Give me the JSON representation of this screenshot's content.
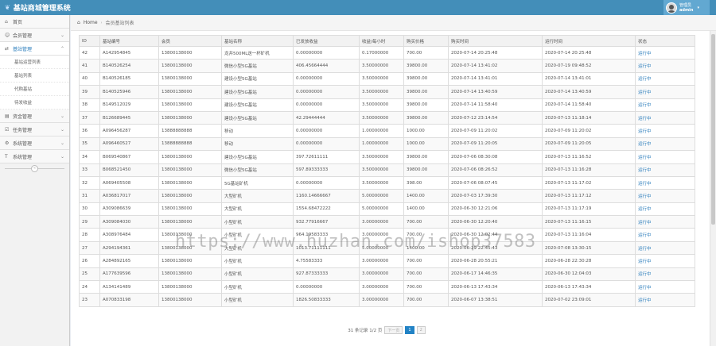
{
  "app": {
    "title": "基站商城管理系统"
  },
  "user": {
    "role": "管理员",
    "name": "admin"
  },
  "sidebar": {
    "items": [
      {
        "label": "首页",
        "icon": "home-icon",
        "has_arrow": false
      },
      {
        "label": "会员管理",
        "icon": "user-icon",
        "has_arrow": true
      },
      {
        "label": "基站管理",
        "icon": "shuffle-icon",
        "has_arrow": true,
        "open": true
      }
    ],
    "subitems": [
      {
        "label": "基站运营列表"
      },
      {
        "label": "基站列表"
      },
      {
        "label": "代购基站"
      },
      {
        "label": "待发收益"
      }
    ],
    "more_items": [
      {
        "label": "资金管理",
        "icon": "wallet-icon"
      },
      {
        "label": "任务管理",
        "icon": "task-icon"
      },
      {
        "label": "系统管理",
        "icon": "gear-icon"
      },
      {
        "label": "系统管理",
        "icon": "text-icon"
      }
    ]
  },
  "breadcrumb": {
    "home": "Home",
    "current": "会员基站列表"
  },
  "table": {
    "columns": [
      "ID",
      "基站编号",
      "会员",
      "基站名称",
      "已发放收益",
      "收益/每小时",
      "购买价格",
      "购买时间",
      "运行时间",
      "状态"
    ],
    "rows": [
      [
        "42",
        "A142954845",
        "13800138000",
        "龙井500ML送一杯矿机",
        "0.00000000",
        "0.17000000",
        "700.00",
        "2020-07-14 20:25:48",
        "2020-07-14 20:25:48",
        "运行中"
      ],
      [
        "41",
        "B140526254",
        "13800138000",
        "微信小型5G基站",
        "406.45664444",
        "3.50000000",
        "39800.00",
        "2020-07-14 13:41:02",
        "2020-07-19 09:48:52",
        "运行中"
      ],
      [
        "40",
        "B140526185",
        "13800138000",
        "建设小型5G基站",
        "0.00000000",
        "3.50000000",
        "39800.00",
        "2020-07-14 13:41:01",
        "2020-07-14 13:41:01",
        "运行中"
      ],
      [
        "39",
        "B140525946",
        "13800138000",
        "建设小型5G基站",
        "0.00000000",
        "3.50000000",
        "39800.00",
        "2020-07-14 13:40:59",
        "2020-07-14 13:40:59",
        "运行中"
      ],
      [
        "38",
        "B149512029",
        "13800138000",
        "建设小型5G基站",
        "0.00000000",
        "3.50000000",
        "39800.00",
        "2020-07-14 11:58:40",
        "2020-07-14 11:58:40",
        "运行中"
      ],
      [
        "37",
        "B126689445",
        "13800138000",
        "建设小型5G基站",
        "42.29444444",
        "3.50000000",
        "39800.00",
        "2020-07-12 23:14:54",
        "2020-07-13 11:18:14",
        "运行中"
      ],
      [
        "36",
        "A096456287",
        "13888888888",
        "移动",
        "0.00000000",
        "1.00000000",
        "1000.00",
        "2020-07-09 11:20:02",
        "2020-07-09 11:20:02",
        "运行中"
      ],
      [
        "35",
        "A096460527",
        "13888888888",
        "移动",
        "0.00000000",
        "1.00000000",
        "1000.00",
        "2020-07-09 11:20:05",
        "2020-07-09 11:20:05",
        "运行中"
      ],
      [
        "34",
        "B069540867",
        "13800138000",
        "建设小型5G基站",
        "397.72611111",
        "3.50000000",
        "39800.00",
        "2020-07-06 08:30:08",
        "2020-07-13 11:16:52",
        "运行中"
      ],
      [
        "33",
        "B068521450",
        "13800138000",
        "微信小型5G基站",
        "597.89333333",
        "3.50000000",
        "39800.00",
        "2020-07-06 08:26:52",
        "2020-07-13 11:16:28",
        "运行中"
      ],
      [
        "32",
        "A069405508",
        "13800138000",
        "5G基站矿机",
        "0.00000000",
        "3.50000000",
        "398.00",
        "2020-07-06 08:07:45",
        "2020-07-13 11:17:02",
        "运行中"
      ],
      [
        "31",
        "A036817017",
        "13800138000",
        "大型矿机",
        "1160.14666667",
        "5.00000000",
        "1400.00",
        "2020-07-03 17:39:30",
        "2020-07-13 11:17:12",
        "运行中"
      ],
      [
        "30",
        "A309086639",
        "13800138000",
        "大型矿机",
        "1554.68472222",
        "5.00000000",
        "1400.00",
        "2020-06-30 12:21:06",
        "2020-07-13 11:17:19",
        "运行中"
      ],
      [
        "29",
        "A309084030",
        "13800138000",
        "小型矿机",
        "932.77916667",
        "3.00000000",
        "700.00",
        "2020-06-30 12:20:40",
        "2020-07-13 11:16:15",
        "运行中"
      ],
      [
        "28",
        "A308976484",
        "13800138000",
        "小型矿机",
        "964.19583333",
        "3.00000000",
        "700.00",
        "2020-06-30 12:02:44",
        "2020-07-13 11:16:04",
        "运行中"
      ],
      [
        "27",
        "A294194361",
        "13800138000",
        "大型矿机",
        "1013.71111111",
        "5.00000000",
        "1400.00",
        "2020-06-29 22:45:43",
        "2020-07-08 13:30:15",
        "运行中"
      ],
      [
        "26",
        "A284892165",
        "13800138000",
        "小型矿机",
        "4.75583333",
        "3.00000000",
        "700.00",
        "2020-06-28 20:55:21",
        "2020-06-28 22:30:28",
        "运行中"
      ],
      [
        "25",
        "A177639596",
        "13800138000",
        "小型矿机",
        "927.87333333",
        "3.00000000",
        "700.00",
        "2020-06-17 14:46:35",
        "2020-06-30 12:04:03",
        "运行中"
      ],
      [
        "24",
        "A134141489",
        "13800138000",
        "小型矿机",
        "0.00000000",
        "3.00000000",
        "700.00",
        "2020-06-13 17:43:34",
        "2020-06-13 17:43:34",
        "运行中"
      ],
      [
        "23",
        "A070833198",
        "13800138000",
        "小型矿机",
        "1826.50833333",
        "3.00000000",
        "700.00",
        "2020-06-07 13:38:51",
        "2020-07-02 23:09:01",
        "运行中"
      ]
    ]
  },
  "pager": {
    "summary": "31 条记录 1/2 页",
    "prev": "下一页",
    "pages": [
      "1",
      "2"
    ],
    "current": "1"
  },
  "watermark": "https://www.huzhan.com/ishop37583"
}
